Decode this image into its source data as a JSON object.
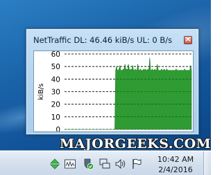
{
  "gadget": {
    "title": "NetTraffic DL: 46.46 kiB/s UL: 0 B/s",
    "close_symbol": "×"
  },
  "chart_data": {
    "type": "area",
    "ylabel": "kiB/s",
    "ylim": [
      0,
      60
    ],
    "yticks": [
      "0",
      "10",
      "20",
      "30",
      "40",
      "50",
      "60"
    ],
    "grid": true,
    "series": [
      {
        "color": "#2e9b33",
        "values": [
          0,
          0,
          0,
          0,
          0,
          0,
          0,
          0,
          0,
          0,
          0,
          0,
          0,
          0,
          0,
          0,
          0,
          0,
          0,
          0,
          0,
          0,
          0,
          0,
          0,
          0,
          0,
          0,
          0,
          0,
          0,
          0,
          0,
          0,
          0,
          0,
          0,
          0,
          0,
          0,
          0,
          0,
          0,
          0,
          0,
          0,
          0,
          0,
          0,
          0,
          0,
          0,
          0,
          0,
          0,
          0,
          0,
          0,
          0,
          0,
          47,
          50,
          47,
          47,
          48,
          51,
          47,
          47,
          47,
          48,
          48,
          52,
          47,
          48,
          47,
          52,
          48,
          47,
          48,
          47,
          51,
          47,
          47,
          48,
          47,
          47,
          52,
          47,
          47,
          48,
          47,
          47,
          47,
          48,
          47,
          48,
          47,
          47,
          48,
          47,
          57,
          47,
          47,
          48,
          47,
          47,
          48,
          47,
          47,
          52,
          47,
          47,
          47,
          47,
          48,
          47,
          47,
          48,
          47,
          47,
          48,
          47,
          47,
          47,
          47,
          47,
          47,
          47,
          47,
          47,
          47,
          48,
          47,
          47,
          47,
          47,
          47,
          47,
          47,
          47,
          47,
          48,
          47,
          47,
          47,
          47,
          47,
          47,
          51,
          47
        ]
      }
    ]
  },
  "watermark": "MAJORGEEKS.COM",
  "taskbar": {
    "tray_icons": [
      "safely-remove-hardware-icon",
      "nettraffic-tray-icon",
      "security-shield-icon",
      "network-icon",
      "volume-icon",
      "action-center-flag-icon"
    ],
    "time": "10:42 AM",
    "date": "2/4/2016"
  },
  "colors": {
    "area_fill": "#2e9b33",
    "area_stroke": "#1f7a24",
    "gadget_bg": "#b5d6f1",
    "taskbar_bg": "#d6e1ee"
  }
}
